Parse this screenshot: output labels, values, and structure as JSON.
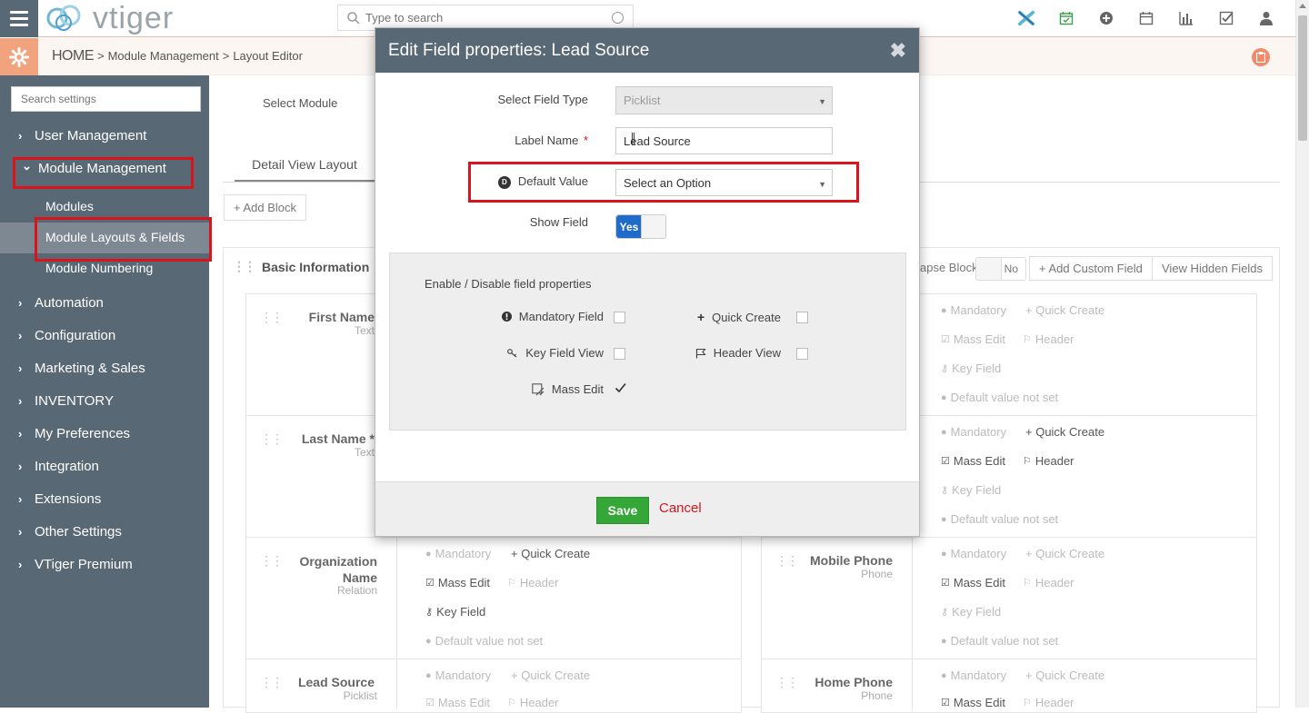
{
  "header": {
    "search_placeholder": "Type to search"
  },
  "breadcrumb": {
    "home": "HOME",
    "sep1": ">",
    "module_mgmt": "Module Management",
    "sep2": ">",
    "layout_editor": "Layout Editor"
  },
  "sidebar": {
    "search_placeholder": "Search settings",
    "items": [
      {
        "label": "User Management",
        "arrow": "›"
      },
      {
        "label": "Module Management",
        "arrow": "⌄"
      },
      {
        "label": "Automation",
        "arrow": "›"
      },
      {
        "label": "Configuration",
        "arrow": "›"
      },
      {
        "label": "Marketing & Sales",
        "arrow": "›"
      },
      {
        "label": "INVENTORY",
        "arrow": "›"
      },
      {
        "label": "My Preferences",
        "arrow": "›"
      },
      {
        "label": "Integration",
        "arrow": "›"
      },
      {
        "label": "Extensions",
        "arrow": "›"
      },
      {
        "label": "Other Settings",
        "arrow": "›"
      },
      {
        "label": "VTiger Premium",
        "arrow": "›"
      }
    ],
    "subitems": [
      {
        "label": "Modules"
      },
      {
        "label": "Module Layouts & Fields"
      },
      {
        "label": "Module Numbering"
      }
    ]
  },
  "main": {
    "select_module_label": "Select Module",
    "tab_detail": "Detail View Layout",
    "add_block": "+ Add Block",
    "block_title": "Basic Information",
    "collapse_label": "apse Block",
    "collapse_toggle": "No",
    "add_custom_field": "+ Add Custom Field",
    "view_hidden_fields": "View Hidden Fields",
    "fields_left": [
      {
        "name": "First Name",
        "type": "Text"
      },
      {
        "name": "Last Name *",
        "type": "Text"
      },
      {
        "name": "Organization Name",
        "type": "Relation"
      },
      {
        "name": "Lead Source",
        "type": "Picklist"
      }
    ],
    "fields_right": [
      {
        "name": "Mobile Phone",
        "type": "Phone"
      },
      {
        "name": "Home Phone",
        "type": "Phone"
      }
    ],
    "props": {
      "mandatory": "Mandatory",
      "quick_create": "+ Quick Create",
      "mass_edit": "Mass Edit",
      "header": "Header",
      "key_field": "Key Field",
      "default_not_set": "Default value not set"
    }
  },
  "modal": {
    "title": "Edit Field properties: Lead Source",
    "close": "✖",
    "select_field_type_label": "Select Field Type",
    "select_field_type_value": "Picklist",
    "label_name_label": "Label Name",
    "label_name_required": "*",
    "label_name_value": "Lead Source",
    "default_value_label": "Default Value",
    "default_value_badge": "D",
    "default_value_placeholder": "Select an Option",
    "show_field_label": "Show Field",
    "show_field_toggle": "Yes",
    "props_title": "Enable / Disable field properties",
    "mandatory_label": "Mandatory Field",
    "quick_create_label": "Quick Create",
    "key_field_label": "Key Field View",
    "header_view_label": "Header View",
    "mass_edit_label": "Mass Edit",
    "mandatory_checked": false,
    "quick_create_checked": false,
    "key_field_checked": false,
    "header_view_checked": false,
    "mass_edit_checked": true,
    "save": "Save",
    "cancel": "Cancel"
  },
  "colors": {
    "sidebar_bg": "#596875",
    "accent_orange": "#f0a37c",
    "highlight_red": "#d9151b",
    "save_green": "#35a638",
    "toggle_blue": "#1f6bc9"
  }
}
